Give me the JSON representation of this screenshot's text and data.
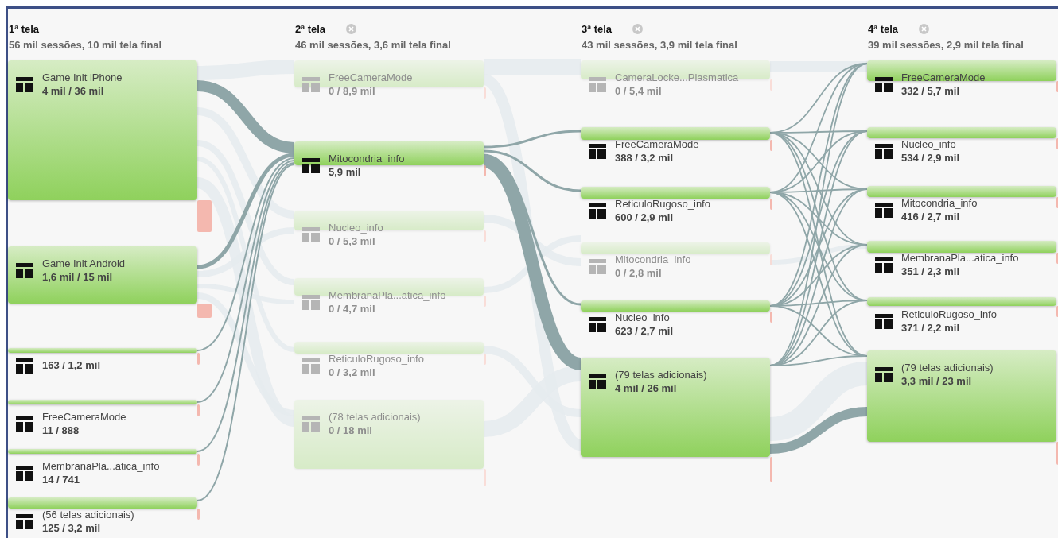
{
  "columns": [
    {
      "title": "1ª tela",
      "closable": false,
      "summary": "56 mil sessões, 10 mil tela final",
      "nodes": [
        {
          "name": "Game Init iPhone",
          "value": "4 mil / 36 mil",
          "dimmed": false
        },
        {
          "name": "Game Init Android",
          "value": "1,6 mil / 15 mil",
          "dimmed": false
        },
        {
          "value": "163 / 1,2 mil",
          "dimmed": false
        },
        {
          "name": "FreeCameraMode",
          "value": "11 / 888",
          "dimmed": false
        },
        {
          "name": "MembranaPla...atica_info",
          "value": "14 / 741",
          "dimmed": false
        },
        {
          "name": "(56 telas adicionais)",
          "value": "125 / 3,2 mil",
          "dimmed": false
        }
      ]
    },
    {
      "title": "2ª tela",
      "closable": true,
      "summary": "46 mil sessões, 3,6 mil tela final",
      "nodes": [
        {
          "name": "FreeCameraMode",
          "value": "0 / 8,9 mil",
          "dimmed": true
        },
        {
          "name": "Mitocondria_info",
          "value": "5,9 mil",
          "dimmed": false
        },
        {
          "name": "Nucleo_info",
          "value": "0 / 5,3 mil",
          "dimmed": true
        },
        {
          "name": "MembranaPla...atica_info",
          "value": "0 / 4,7 mil",
          "dimmed": true
        },
        {
          "name": "ReticuloRugoso_info",
          "value": "0 / 3,2 mil",
          "dimmed": true
        },
        {
          "name": "(78 telas adicionais)",
          "value": "0 / 18 mil",
          "dimmed": true
        }
      ]
    },
    {
      "title": "3ª tela",
      "closable": true,
      "summary": "43 mil sessões, 3,9 mil tela final",
      "nodes": [
        {
          "name": "CameraLocke...Plasmatica",
          "value": "0 / 5,4 mil",
          "dimmed": true
        },
        {
          "name": "FreeCameraMode",
          "value": "388 / 3,2 mil",
          "dimmed": false
        },
        {
          "name": "ReticuloRugoso_info",
          "value": "600 / 2,9 mil",
          "dimmed": false
        },
        {
          "name": "Mitocondria_info",
          "value": "0 / 2,8 mil",
          "dimmed": true
        },
        {
          "name": "Nucleo_info",
          "value": "623 / 2,7 mil",
          "dimmed": false
        },
        {
          "name": "(79 telas adicionais)",
          "value": "4 mil / 26 mil",
          "dimmed": false
        }
      ]
    },
    {
      "title": "4ª tela",
      "closable": true,
      "summary": "39 mil sessões, 2,9 mil tela final",
      "nodes": [
        {
          "name": "FreeCameraMode",
          "value": "332 / 5,7 mil",
          "dimmed": false
        },
        {
          "name": "Nucleo_info",
          "value": "534 / 2,9 mil",
          "dimmed": false
        },
        {
          "name": "Mitocondria_info",
          "value": "416 / 2,7 mil",
          "dimmed": false
        },
        {
          "name": "MembranaPla...atica_info",
          "value": "351 / 2,3 mil",
          "dimmed": false
        },
        {
          "name": "ReticuloRugoso_info",
          "value": "371 / 2,2 mil",
          "dimmed": false
        },
        {
          "name": "(79 telas adicionais)",
          "value": "3,3 mil / 23 mil",
          "dimmed": false
        }
      ]
    }
  ]
}
